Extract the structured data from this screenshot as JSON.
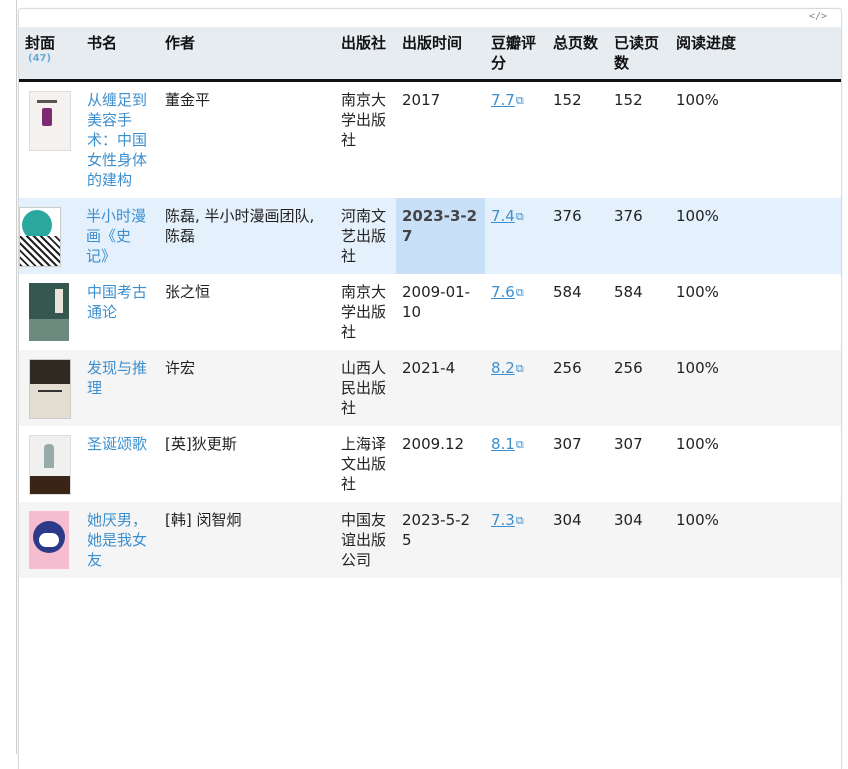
{
  "embed": {
    "icon": "code-icon",
    "glyph": "</>"
  },
  "table": {
    "headers": {
      "cover": "封面",
      "count": "(47)",
      "name": "书名",
      "author": "作者",
      "publisher": "出版社",
      "date": "出版时间",
      "rating": "豆瓣评分",
      "total": "总页数",
      "read": "已读页数",
      "progress": "阅读进度"
    },
    "rows": [
      {
        "title": "从缠足到美容手术：中国女性身体的建构",
        "author": "董金平",
        "publisher": "南京大学出版社",
        "date": "2017",
        "rating": "7.7",
        "total": "152",
        "read": "152",
        "progress": "100%"
      },
      {
        "title": "半小时漫画《史记》",
        "author": "陈磊, 半小时漫画团队, 陈磊",
        "publisher": "河南文艺出版社",
        "date": "2023-3-27",
        "rating": "7.4",
        "total": "376",
        "read": "376",
        "progress": "100%"
      },
      {
        "title": "中国考古通论",
        "author": "张之恒",
        "publisher": "南京大学出版社",
        "date": "2009-01-10",
        "rating": "7.6",
        "total": "584",
        "read": "584",
        "progress": "100%"
      },
      {
        "title": "发现与推理",
        "author": "许宏",
        "publisher": "山西人民出版社",
        "date": "2021-4",
        "rating": "8.2",
        "total": "256",
        "read": "256",
        "progress": "100%"
      },
      {
        "title": "圣诞颂歌",
        "author": "[英]狄更斯",
        "publisher": "上海译文出版社",
        "date": "2009.12",
        "rating": "8.1",
        "total": "307",
        "read": "307",
        "progress": "100%"
      },
      {
        "title": "她厌男，她是我女友",
        "author": "[韩] 闵智炯",
        "publisher": "中国友谊出版公司",
        "date": "2023-5-25",
        "rating": "7.3",
        "total": "304",
        "read": "304",
        "progress": "100%"
      }
    ]
  },
  "colors": {
    "link": "#3c8fcf",
    "header_bg": "#e7ecf1",
    "hover_row": "#e4f0fb",
    "active_cell": "#c8e0f7"
  }
}
